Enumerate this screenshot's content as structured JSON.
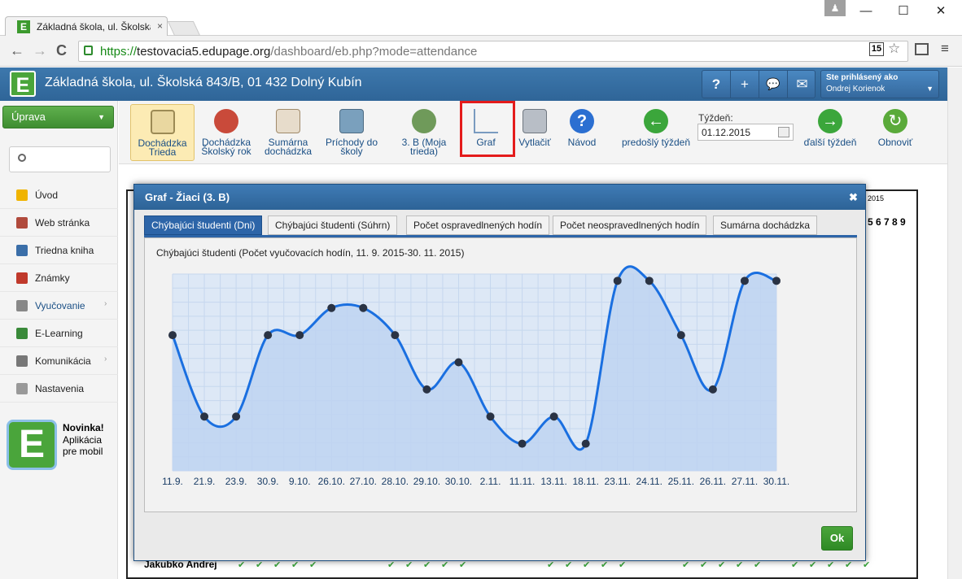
{
  "browser": {
    "tab_title": "Základná škola, ul. Školská",
    "tab_close": "×",
    "user_icon": "♟",
    "win_min": "—",
    "win_max": "☐",
    "win_close": "✕",
    "back": "←",
    "forward": "→",
    "reload": "C",
    "url_scheme": "https://",
    "url_host": "testovacia5.edupage.org",
    "url_path": "/dashboard/eb.php?mode=attendance",
    "ext_badge": "15",
    "star": "☆",
    "menu": "≡"
  },
  "header": {
    "logo": "E",
    "school": "Základná škola, ul. Školská 843/B, 01 432 Dolný Kubín",
    "help": "?",
    "add": "+",
    "chat": "💬",
    "mail": "✉",
    "signed_in_label": "Ste prihlásený ako",
    "user_name": "Ondrej Korienok",
    "caret": "▼"
  },
  "sidebar": {
    "uprava": "Úprava",
    "uprava_caret": "▼",
    "items": [
      {
        "label": "Úvod",
        "icon": "star-icon",
        "color": "#f0b400"
      },
      {
        "label": "Web stránka",
        "icon": "web-icon",
        "color": "#b04a3c"
      },
      {
        "label": "Triedna kniha",
        "icon": "book-icon",
        "color": "#3a6ea8"
      },
      {
        "label": "Známky",
        "icon": "grades-icon",
        "color": "#c0392b"
      },
      {
        "label": "Vyučovanie",
        "icon": "teaching-icon",
        "color": "#888888"
      },
      {
        "label": "E-Learning",
        "icon": "elearning-icon",
        "color": "#3a8a3a"
      },
      {
        "label": "Komunikácia",
        "icon": "communication-icon",
        "color": "#777777"
      },
      {
        "label": "Nastavenia",
        "icon": "settings-icon",
        "color": "#999999"
      }
    ],
    "chevron": "›",
    "promo_logo": "E",
    "promo_title": "Novinka!",
    "promo_line1": "Aplikácia",
    "promo_line2": "pre mobil"
  },
  "toolbar": {
    "dochadzka_trieda_1": "Dochádzka",
    "dochadzka_trieda_2": "Trieda",
    "dochadzka_rok_1": "Dochádzka",
    "dochadzka_rok_2": "Školský rok",
    "sumarna_1": "Sumárna",
    "sumarna_2": "dochádzka",
    "prichody_1": "Príchody do",
    "prichody_2": "školy",
    "trieda_1": "3. B (Moja",
    "trieda_2": "trieda)",
    "graf": "Graf",
    "vytlacit": "Vytlačiť",
    "navod": "Návod",
    "prev_week": "predošlý týždeň",
    "week_label": "Týždeň:",
    "week_value": "01.12.2015",
    "next_week": "ďalší týždeň",
    "refresh": "Obnoviť",
    "arrow_left": "←",
    "arrow_right": "→",
    "refresh_glyph": "↻",
    "help_glyph": "?"
  },
  "background": {
    "year_fragment": "2015",
    "days": "5 6 7 8 9",
    "student": "Jakubko Andrej",
    "check": "✔"
  },
  "dialog": {
    "title": "Graf - Žiaci (3. B)",
    "close": "✖",
    "tabs": [
      "Chýbajúci študenti (Dni)",
      "Chýbajúci študenti (Súhrn)",
      "Počet ospravedlnených hodín",
      "Počet neospravedlnených hodín",
      "Sumárna dochádzka"
    ],
    "ok": "Ok"
  },
  "chart_data": {
    "type": "line",
    "title": "Chýbajúci študenti (Počet vyučovacích hodín, 11. 9. 2015-30. 11. 2015)",
    "categories": [
      "11.9.",
      "21.9.",
      "23.9.",
      "30.9.",
      "9.10.",
      "26.10.",
      "27.10.",
      "28.10.",
      "29.10.",
      "30.10.",
      "2.11.",
      "11.11.",
      "13.11.",
      "18.11.",
      "23.11.",
      "24.11.",
      "25.11.",
      "26.11.",
      "27.11.",
      "30.11."
    ],
    "values": [
      5,
      2,
      2,
      5,
      5,
      6,
      6,
      5,
      3,
      4,
      2,
      1,
      2,
      1,
      7,
      7,
      5,
      3,
      7,
      7
    ],
    "ylim": [
      0,
      7.25
    ],
    "smooth": true,
    "grid": true,
    "colors": {
      "line": "#1a6fe0",
      "fill": "#bed3f1",
      "marker": "#2a3344",
      "grid": "#c6d7ee",
      "plot_bg": "#dde8f6"
    }
  }
}
